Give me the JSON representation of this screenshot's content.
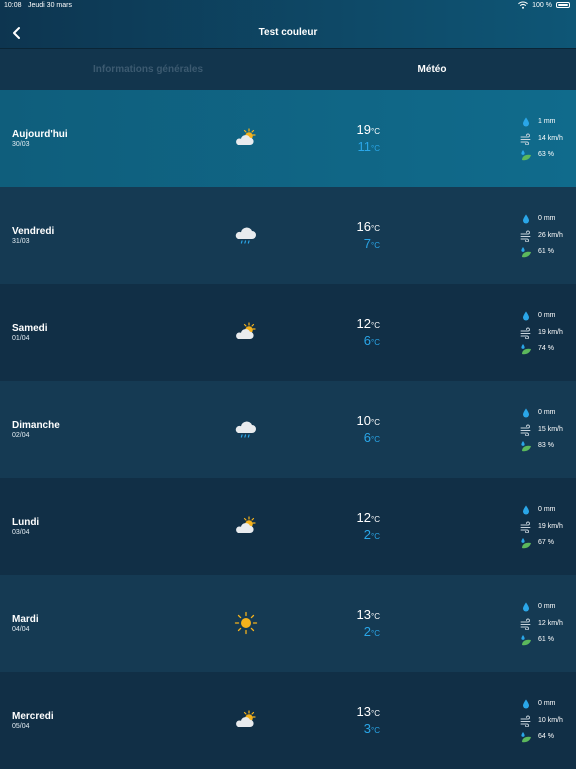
{
  "status_bar": {
    "time": "10:08",
    "date": "Jeudi 30 mars",
    "battery": "100 %"
  },
  "header": {
    "title": "Test couleur",
    "back_icon": "chevron-left-icon"
  },
  "tabs": [
    {
      "label": "Informations générales",
      "active": false
    },
    {
      "label": "Météo",
      "active": true
    }
  ],
  "colors": {
    "accent": "#2aa6e8",
    "today_bg": "#106b8c",
    "header_bg": "#0e5676"
  },
  "days": [
    {
      "day": "Aujourd'hui",
      "date": "30/03",
      "icon": "sun-cloud",
      "max": "19",
      "min": "11",
      "rain": "1 mm",
      "wind": "14 km/h",
      "humidity": "63 %"
    },
    {
      "day": "Vendredi",
      "date": "31/03",
      "icon": "cloud-rain",
      "max": "16",
      "min": "7",
      "rain": "0 mm",
      "wind": "26 km/h",
      "humidity": "61 %"
    },
    {
      "day": "Samedi",
      "date": "01/04",
      "icon": "sun-cloud",
      "max": "12",
      "min": "6",
      "rain": "0 mm",
      "wind": "19 km/h",
      "humidity": "74 %"
    },
    {
      "day": "Dimanche",
      "date": "02/04",
      "icon": "cloud-rain",
      "max": "10",
      "min": "6",
      "rain": "0 mm",
      "wind": "15 km/h",
      "humidity": "83 %"
    },
    {
      "day": "Lundi",
      "date": "03/04",
      "icon": "sun-cloud",
      "max": "12",
      "min": "2",
      "rain": "0 mm",
      "wind": "19 km/h",
      "humidity": "67 %"
    },
    {
      "day": "Mardi",
      "date": "04/04",
      "icon": "sun",
      "max": "13",
      "min": "2",
      "rain": "0 mm",
      "wind": "12 km/h",
      "humidity": "61 %"
    },
    {
      "day": "Mercredi",
      "date": "05/04",
      "icon": "sun-cloud",
      "max": "13",
      "min": "3",
      "rain": "0 mm",
      "wind": "10 km/h",
      "humidity": "64 %"
    }
  ],
  "units": {
    "temperature": "°C"
  }
}
